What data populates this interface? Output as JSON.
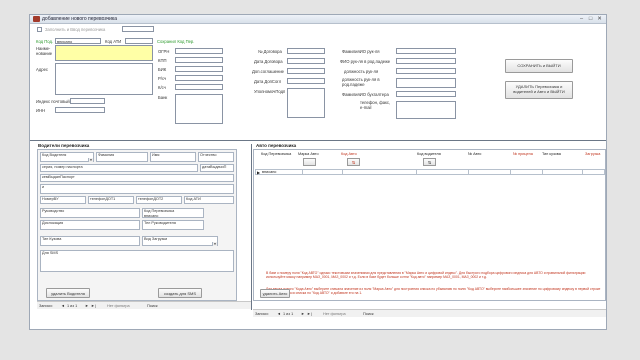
{
  "window": {
    "title": "добавление нового перевозчика",
    "min": "–",
    "max": "□",
    "close": "✕"
  },
  "header": {
    "checkbox_label": "Заполнить и Ввод перевозчика",
    "kod_pod_label": "Код Под.",
    "kod_pod_value": "вписано",
    "kod_ati_label": "Код АТИ",
    "save_kod_label": "Сохранил Код Пер.",
    "name_label": "Наиме-\nнование",
    "address_label": "Адрес",
    "index_label": "Индекс почтовый",
    "inn_label": "ИНН",
    "ogrn_label": "ОГРН",
    "kpp_label": "КПП",
    "bik_label": "БИК",
    "rs_label": "Р/сч",
    "ks_label": "К/сч",
    "bank_label": "Банк",
    "dogovor_label": "№ Договора",
    "date_dog_label": "Дата Договора",
    "dop_sogl_label": "Доп.соглашение",
    "date_dop_label": "Дата ДопСогл",
    "upolnom_label": "УполномочПодп",
    "fio_label": "ФамилияИО рук-ля",
    "fio_rp_label": "ФИО рук-ля в род.падеже",
    "dolzh_label": "должность рук-ля",
    "dolzh_rp_label": "должность рук-ля в род.падеже",
    "buh_label": "ФамилияИО бухгалтера",
    "tel_label": "телефон, факс, e-mail",
    "save_exit_btn": "СОХРАНИТЬ и ВЫЙТИ",
    "delete_exit_btn": "УДАЛИТЬ Перевозчика и водителей и Авто и ВЫЙТИ"
  },
  "drivers": {
    "title": "Водители перевозчика",
    "kod_vod": "Код Водителя",
    "familia": "Фамилия",
    "imya": "Имя",
    "otchestvo": "Отчество",
    "seria": "серия, номер паспорта",
    "vydan": "датаВыдачиП",
    "kem": "кемВыданПаспорт",
    "pole_blank": "и",
    "nomer_vu": "НомерВУ",
    "tel1": "телефонДОТ1",
    "tel2": "телефонДОТ2",
    "kod_ati": "Код АТИ",
    "rukovod": "Руководство",
    "kod_per": "Код Перевозчика",
    "kod_per_val": "вписано",
    "disloc": "Дислокация",
    "tel_ruk": "Тел Руководителя",
    "tip_kuz": "Тип Кузова",
    "vid_zagr": "Вид Загрузки",
    "dlya_sms": "Для SMS",
    "delete_btn": "удалить Водителя",
    "sms_btn": "создать для SMS"
  },
  "nav_left": {
    "label": "Записи:",
    "pos": "1 из 1",
    "filter": "Нет фильтра",
    "search": "Поиск"
  },
  "autos": {
    "title": "Авто перевозчика",
    "cols": [
      "Код Перевозчика",
      "Марка Авто",
      "Код Авто",
      "Код водителя",
      "№ Авто",
      "№ прицепа",
      "Тип кузова",
      "Загрузка"
    ],
    "row_value": "вписано",
    "sort_glyph": "⇅",
    "note1": "В базе к номеру поля \"Код АВТО\" однако текстовыми значениями для представления в \"Марка Авто и цифровой индекс\". Для быстрого подбора цифрового индекса для АВТО и правильной фильтрации используйте маску например МАЗ_0001, МАЗ_0002 и т.д. Если в базе будет больше сотни \"Код авто\" например МАЗ_0001, МАЗ_0002 и т.д.",
    "note2": "Для ввода нового \"Кода Авто\" выберите сначала значение из поля \"Марка Авто\" для построения списка по убыванию по полю \"Код АВТО\" выберите наибольшее значение по цифровому индексу в первой строке раскрывающегося списка по \"Код АВТО\" и добавьте его на 1.",
    "delete_btn": "удалить Авто"
  },
  "nav_right": {
    "label": "Записи:",
    "pos": "1 из 1",
    "filter": "Нет фильтра",
    "search": "Поиск"
  }
}
